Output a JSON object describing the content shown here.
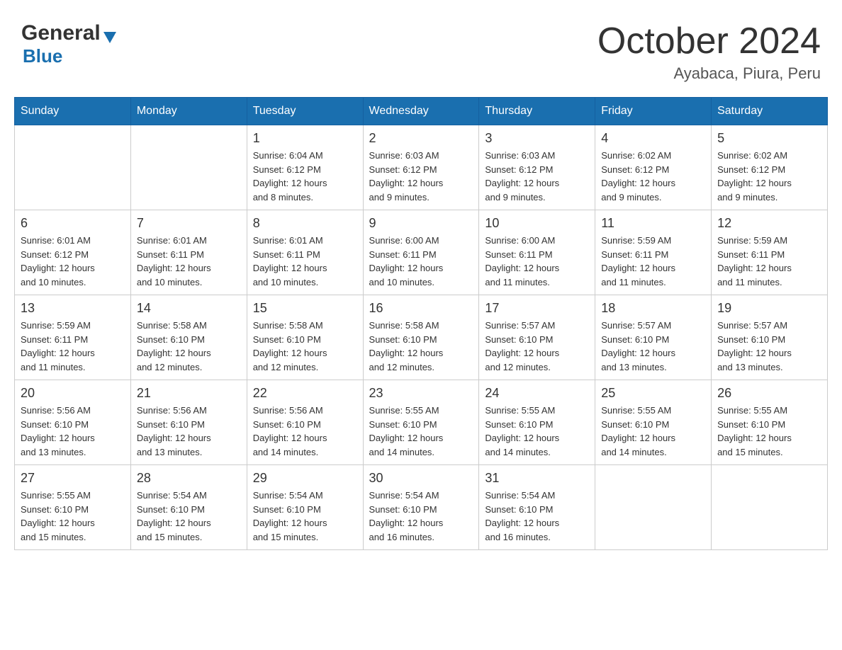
{
  "header": {
    "logo_general": "General",
    "logo_blue": "Blue",
    "main_title": "October 2024",
    "subtitle": "Ayabaca, Piura, Peru"
  },
  "calendar": {
    "days_of_week": [
      "Sunday",
      "Monday",
      "Tuesday",
      "Wednesday",
      "Thursday",
      "Friday",
      "Saturday"
    ],
    "weeks": [
      [
        {
          "day": "",
          "info": ""
        },
        {
          "day": "",
          "info": ""
        },
        {
          "day": "1",
          "info": "Sunrise: 6:04 AM\nSunset: 6:12 PM\nDaylight: 12 hours\nand 8 minutes."
        },
        {
          "day": "2",
          "info": "Sunrise: 6:03 AM\nSunset: 6:12 PM\nDaylight: 12 hours\nand 9 minutes."
        },
        {
          "day": "3",
          "info": "Sunrise: 6:03 AM\nSunset: 6:12 PM\nDaylight: 12 hours\nand 9 minutes."
        },
        {
          "day": "4",
          "info": "Sunrise: 6:02 AM\nSunset: 6:12 PM\nDaylight: 12 hours\nand 9 minutes."
        },
        {
          "day": "5",
          "info": "Sunrise: 6:02 AM\nSunset: 6:12 PM\nDaylight: 12 hours\nand 9 minutes."
        }
      ],
      [
        {
          "day": "6",
          "info": "Sunrise: 6:01 AM\nSunset: 6:12 PM\nDaylight: 12 hours\nand 10 minutes."
        },
        {
          "day": "7",
          "info": "Sunrise: 6:01 AM\nSunset: 6:11 PM\nDaylight: 12 hours\nand 10 minutes."
        },
        {
          "day": "8",
          "info": "Sunrise: 6:01 AM\nSunset: 6:11 PM\nDaylight: 12 hours\nand 10 minutes."
        },
        {
          "day": "9",
          "info": "Sunrise: 6:00 AM\nSunset: 6:11 PM\nDaylight: 12 hours\nand 10 minutes."
        },
        {
          "day": "10",
          "info": "Sunrise: 6:00 AM\nSunset: 6:11 PM\nDaylight: 12 hours\nand 11 minutes."
        },
        {
          "day": "11",
          "info": "Sunrise: 5:59 AM\nSunset: 6:11 PM\nDaylight: 12 hours\nand 11 minutes."
        },
        {
          "day": "12",
          "info": "Sunrise: 5:59 AM\nSunset: 6:11 PM\nDaylight: 12 hours\nand 11 minutes."
        }
      ],
      [
        {
          "day": "13",
          "info": "Sunrise: 5:59 AM\nSunset: 6:11 PM\nDaylight: 12 hours\nand 11 minutes."
        },
        {
          "day": "14",
          "info": "Sunrise: 5:58 AM\nSunset: 6:10 PM\nDaylight: 12 hours\nand 12 minutes."
        },
        {
          "day": "15",
          "info": "Sunrise: 5:58 AM\nSunset: 6:10 PM\nDaylight: 12 hours\nand 12 minutes."
        },
        {
          "day": "16",
          "info": "Sunrise: 5:58 AM\nSunset: 6:10 PM\nDaylight: 12 hours\nand 12 minutes."
        },
        {
          "day": "17",
          "info": "Sunrise: 5:57 AM\nSunset: 6:10 PM\nDaylight: 12 hours\nand 12 minutes."
        },
        {
          "day": "18",
          "info": "Sunrise: 5:57 AM\nSunset: 6:10 PM\nDaylight: 12 hours\nand 13 minutes."
        },
        {
          "day": "19",
          "info": "Sunrise: 5:57 AM\nSunset: 6:10 PM\nDaylight: 12 hours\nand 13 minutes."
        }
      ],
      [
        {
          "day": "20",
          "info": "Sunrise: 5:56 AM\nSunset: 6:10 PM\nDaylight: 12 hours\nand 13 minutes."
        },
        {
          "day": "21",
          "info": "Sunrise: 5:56 AM\nSunset: 6:10 PM\nDaylight: 12 hours\nand 13 minutes."
        },
        {
          "day": "22",
          "info": "Sunrise: 5:56 AM\nSunset: 6:10 PM\nDaylight: 12 hours\nand 14 minutes."
        },
        {
          "day": "23",
          "info": "Sunrise: 5:55 AM\nSunset: 6:10 PM\nDaylight: 12 hours\nand 14 minutes."
        },
        {
          "day": "24",
          "info": "Sunrise: 5:55 AM\nSunset: 6:10 PM\nDaylight: 12 hours\nand 14 minutes."
        },
        {
          "day": "25",
          "info": "Sunrise: 5:55 AM\nSunset: 6:10 PM\nDaylight: 12 hours\nand 14 minutes."
        },
        {
          "day": "26",
          "info": "Sunrise: 5:55 AM\nSunset: 6:10 PM\nDaylight: 12 hours\nand 15 minutes."
        }
      ],
      [
        {
          "day": "27",
          "info": "Sunrise: 5:55 AM\nSunset: 6:10 PM\nDaylight: 12 hours\nand 15 minutes."
        },
        {
          "day": "28",
          "info": "Sunrise: 5:54 AM\nSunset: 6:10 PM\nDaylight: 12 hours\nand 15 minutes."
        },
        {
          "day": "29",
          "info": "Sunrise: 5:54 AM\nSunset: 6:10 PM\nDaylight: 12 hours\nand 15 minutes."
        },
        {
          "day": "30",
          "info": "Sunrise: 5:54 AM\nSunset: 6:10 PM\nDaylight: 12 hours\nand 16 minutes."
        },
        {
          "day": "31",
          "info": "Sunrise: 5:54 AM\nSunset: 6:10 PM\nDaylight: 12 hours\nand 16 minutes."
        },
        {
          "day": "",
          "info": ""
        },
        {
          "day": "",
          "info": ""
        }
      ]
    ]
  }
}
